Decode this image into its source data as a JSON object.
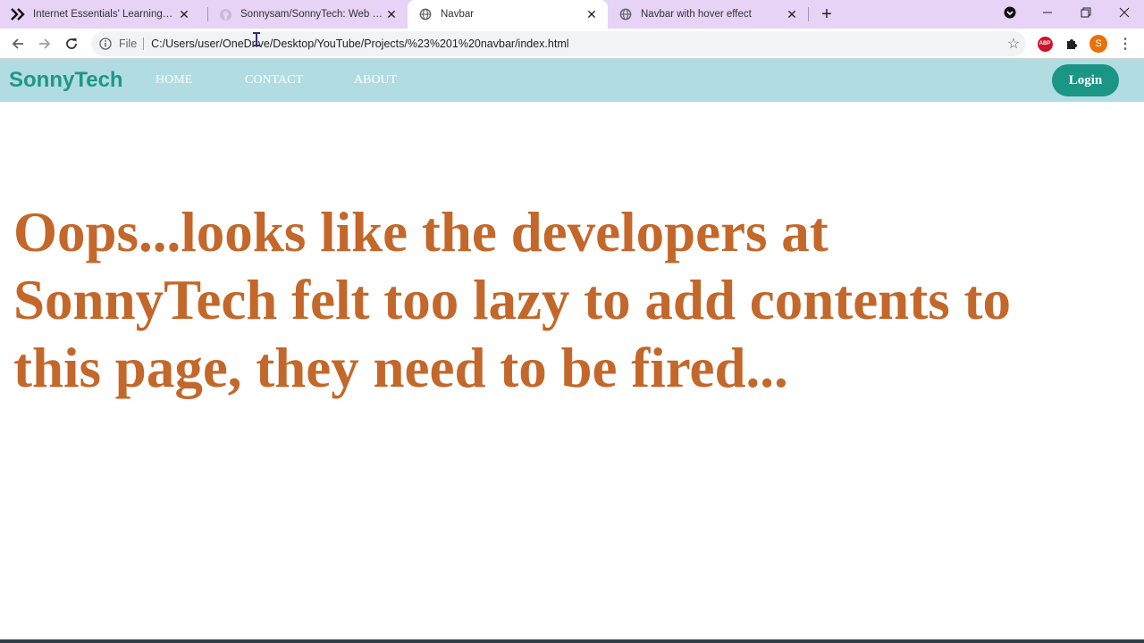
{
  "browser": {
    "tabs": [
      {
        "title": "Internet Essentials' Learning Cent",
        "icon": "chevron-double-icon",
        "active": false
      },
      {
        "title": "Sonnysam/SonnyTech: Web Deve",
        "icon": "github-icon",
        "active": false
      },
      {
        "title": "Navbar",
        "icon": "globe-icon",
        "active": true
      },
      {
        "title": "Navbar with hover effect",
        "icon": "globe-icon",
        "active": false
      }
    ],
    "new_tab": "+",
    "address": {
      "scheme": "File",
      "url": "C:/Users/user/OneDrive/Desktop/YouTube/Projects/%23%201%20navbar/index.html"
    },
    "extensions": {
      "abp_label": "ABP",
      "profile_initial": "S"
    },
    "colors": {
      "tabstrip": "#e6d3f5",
      "profile": "#e8710a"
    }
  },
  "site": {
    "brand": "SonnyTech",
    "nav": {
      "home": "HOME",
      "contact": "CONTACT",
      "about": "ABOUT"
    },
    "login": "Login",
    "headline": "Oops...looks like the developers at SonnyTech felt too lazy to add contents to this page, they need to be fired...",
    "colors": {
      "navbar": "#b0dce2",
      "brand": "#1f9688",
      "login": "#1b9585",
      "headline": "#c3672a"
    }
  }
}
